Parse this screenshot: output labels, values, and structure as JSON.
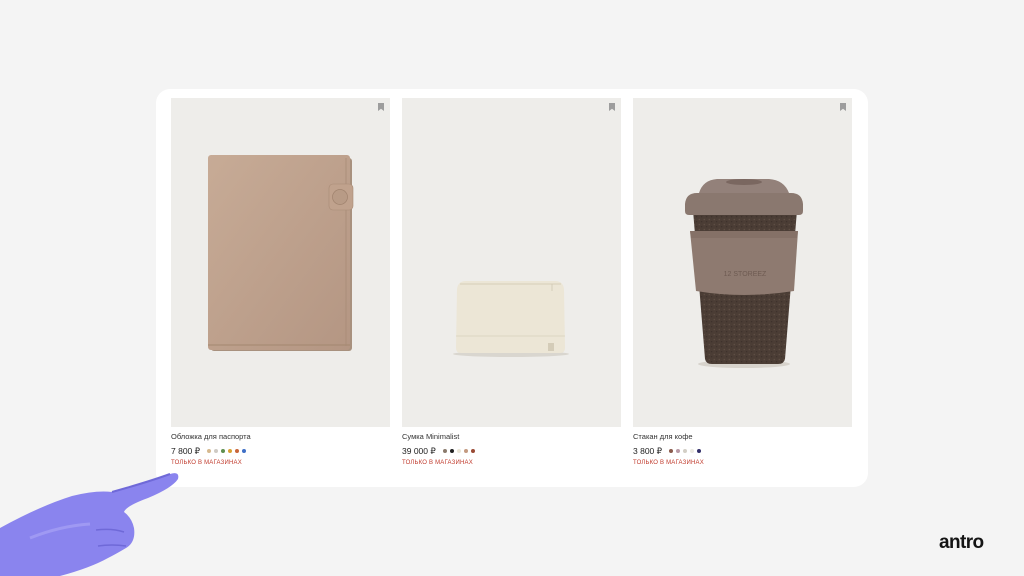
{
  "products": [
    {
      "name": "Обложка для паспорта",
      "price": "7 800 ₽",
      "availability": "ТОЛЬКО В МАГАЗИНАХ",
      "colors": [
        "#d6b98f",
        "#cfcac4",
        "#5f8f4e",
        "#d9a233",
        "#c9663a",
        "#3f6fc6"
      ],
      "image": "passport-cover"
    },
    {
      "name": "Сумка Minimalist",
      "price": "39 000 ₽",
      "availability": "ТОЛЬКО В МАГАЗИНАХ",
      "colors": [
        "#8a7a6c",
        "#222222",
        "#ebe6d8",
        "#c49a80",
        "#9a4a34"
      ],
      "image": "minimalist-bag"
    },
    {
      "name": "Стакан для кофе",
      "price": "3 800 ₽",
      "availability": "ТОЛЬКО В МАГАЗИНАХ",
      "colors": [
        "#8a5a4c",
        "#b99aa6",
        "#d3cfc6",
        "#ebe9e2",
        "#33306a"
      ],
      "image": "coffee-cup"
    }
  ],
  "cup_print": "12 STOREEZ",
  "brand": "antro"
}
